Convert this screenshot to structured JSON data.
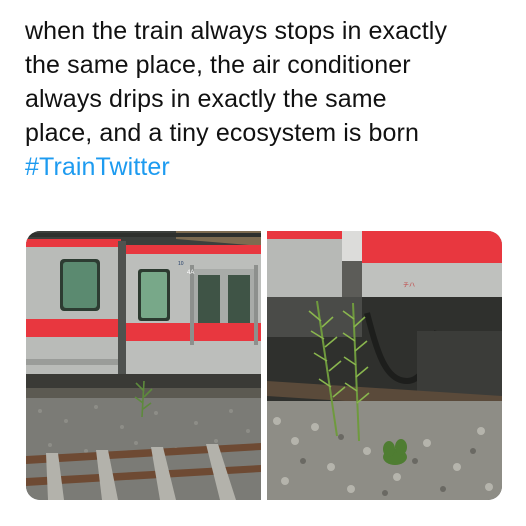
{
  "tweet": {
    "lines": [
      "when the train always stops in exactly",
      "the same place, the air conditioner",
      "always drips in exactly the same",
      "place, and a tiny ecosystem is born"
    ],
    "hashtag": "#TrainTwitter"
  },
  "train_markings": {
    "car_number": "10",
    "door_label": "4A",
    "kanji_label": "チハ"
  },
  "colors": {
    "train_body": "#b9bbb8",
    "train_stripe": "#e8373f",
    "hashtag": "#1d9bf0"
  }
}
